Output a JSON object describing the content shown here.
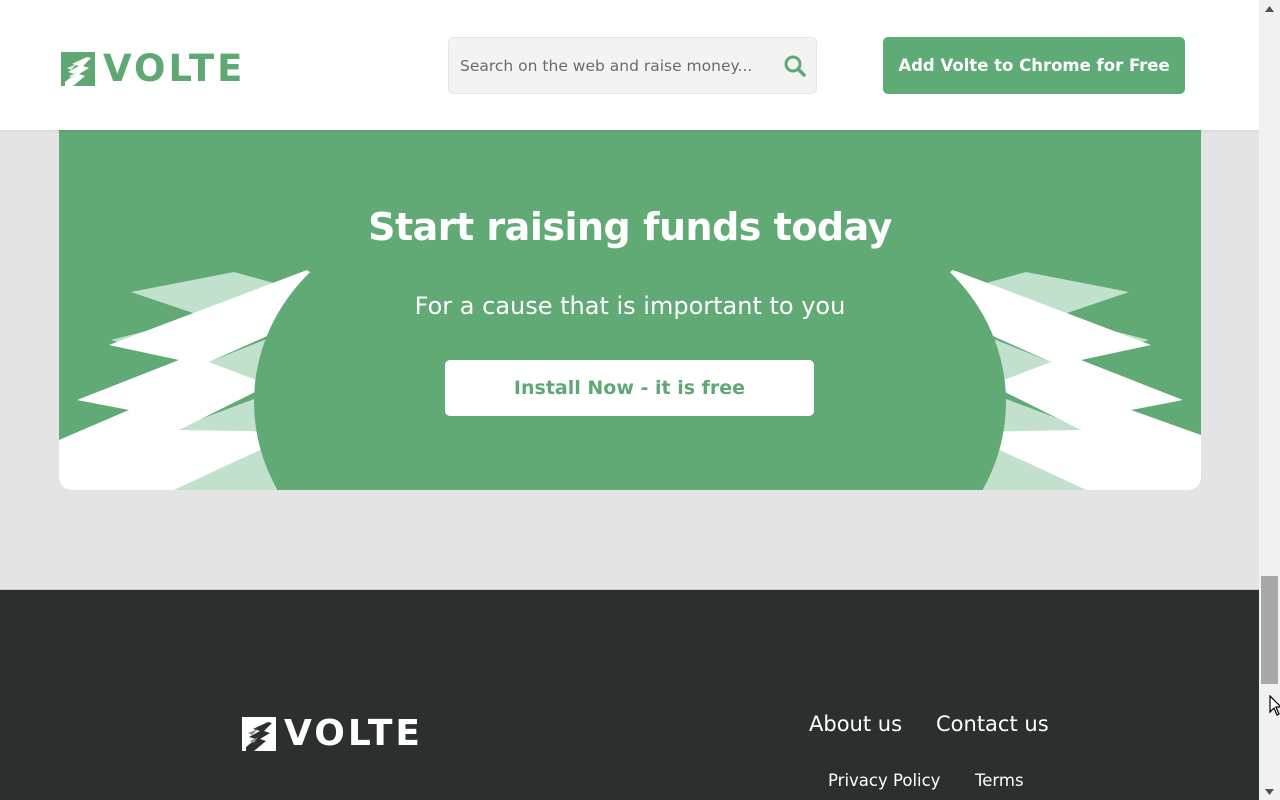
{
  "brand": {
    "name": "VOLTE",
    "accent_color": "#5fab75",
    "light_accent_color": "#c2e1cc",
    "footer_bg": "#2b2f2d"
  },
  "header": {
    "logo_text": "VOLTE",
    "search": {
      "placeholder": "Search on the web and raise money...",
      "value": "",
      "icon": "search-icon"
    },
    "cta_label": "Add Volte to Chrome for Free"
  },
  "banner": {
    "title": "Start raising funds today",
    "subtitle": "For a cause that is important to you",
    "button_label": "Install Now - it is free"
  },
  "footer": {
    "logo_text": "VOLTE",
    "links_primary": [
      {
        "label": "About us"
      },
      {
        "label": "Contact us"
      }
    ],
    "links_secondary": [
      {
        "label": "Privacy Policy"
      },
      {
        "label": "Terms"
      }
    ]
  },
  "scrollbar": {
    "position_fraction": 0.85
  }
}
